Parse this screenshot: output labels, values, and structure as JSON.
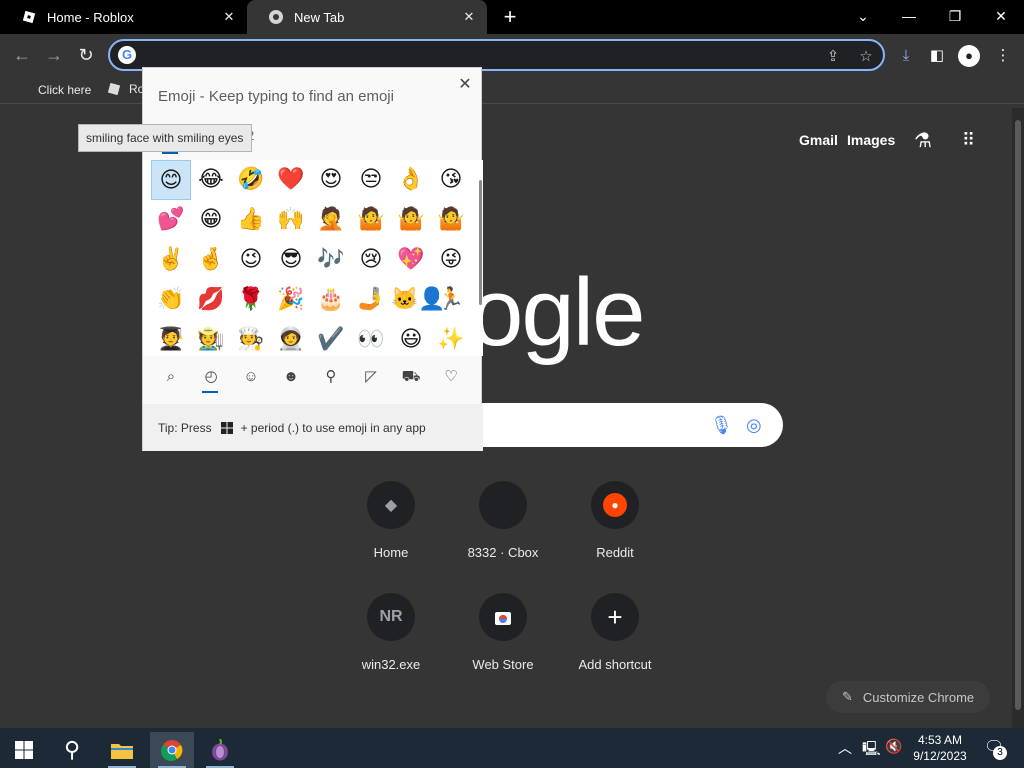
{
  "tabs": [
    {
      "title": "Home - Roblox",
      "close": "✕"
    },
    {
      "title": "New Tab",
      "close": "✕"
    }
  ],
  "new_tab_symbol": "+",
  "window_controls": {
    "tab_search": "⌄",
    "minimize": "—",
    "restore": "❐",
    "close": "✕"
  },
  "toolbar": {
    "back": "←",
    "forward": "→",
    "reload": "↻",
    "address_value": ""
  },
  "bookmarks": [
    {
      "label": "Click here"
    },
    {
      "label": "Ro"
    }
  ],
  "emoji_panel": {
    "title": "Emoji - Keep typing to find an emoji",
    "close": "✕",
    "tooltip": "smiling face with smiling eyes",
    "tooltip_suffix": "2",
    "rows": [
      [
        "😊",
        "😂",
        "🤣",
        "❤️",
        "😍",
        "😒",
        "👌",
        "😘"
      ],
      [
        "💕",
        "😁",
        "👍",
        "🙌",
        "🤦",
        "🤷",
        "🤷",
        "🤷"
      ],
      [
        "✌️",
        "🤞",
        "😉",
        "😎",
        "🎶",
        "😢",
        "💖",
        "😜"
      ],
      [
        "👏",
        "💋",
        "🌹",
        "🎉",
        "🎂",
        "🤳",
        "🐱‍👤",
        "🏃"
      ],
      [
        "🧑‍🎓",
        "🧑‍🌾",
        "🧑‍🍳",
        "🧑‍🚀",
        "✔️",
        "👀",
        "😃",
        "✨"
      ]
    ],
    "categories": [
      {
        "name": "search",
        "glyph": "⌕"
      },
      {
        "name": "recent",
        "glyph": "◴"
      },
      {
        "name": "smileys",
        "glyph": "☺"
      },
      {
        "name": "people",
        "glyph": "☻"
      },
      {
        "name": "celebrations",
        "glyph": "⚲"
      },
      {
        "name": "food",
        "glyph": "◸"
      },
      {
        "name": "travel",
        "glyph": "⛟"
      },
      {
        "name": "symbols",
        "glyph": "♡"
      }
    ],
    "tip_prefix": "Tip: Press",
    "tip_suffix": "+ period (.) to use emoji in any app"
  },
  "page": {
    "links": [
      "Gmail",
      "Images"
    ],
    "logo_partial": "ogle",
    "shortcuts": [
      {
        "label": "Home",
        "icon": "roblox-icon",
        "glyph": "◆"
      },
      {
        "label": "8332 · Cbox",
        "icon": "blank-icon",
        "glyph": ""
      },
      {
        "label": "Reddit",
        "icon": "reddit-icon",
        "glyph": "●"
      },
      {
        "label": "win32.exe",
        "icon": "text-icon",
        "glyph": "NR"
      },
      {
        "label": "Web Store",
        "icon": "webstore-icon",
        "glyph": "▣"
      },
      {
        "label": "Add shortcut",
        "icon": "plus-icon",
        "glyph": "+"
      }
    ],
    "customize_label": "Customize Chrome"
  },
  "taskbar": {
    "time": "4:53 AM",
    "date": "9/12/2023",
    "notifications": "3"
  },
  "colors": {
    "accent": "#8ab4f8",
    "selection": "#cce4f7",
    "taskbar": "#1c2a38"
  }
}
